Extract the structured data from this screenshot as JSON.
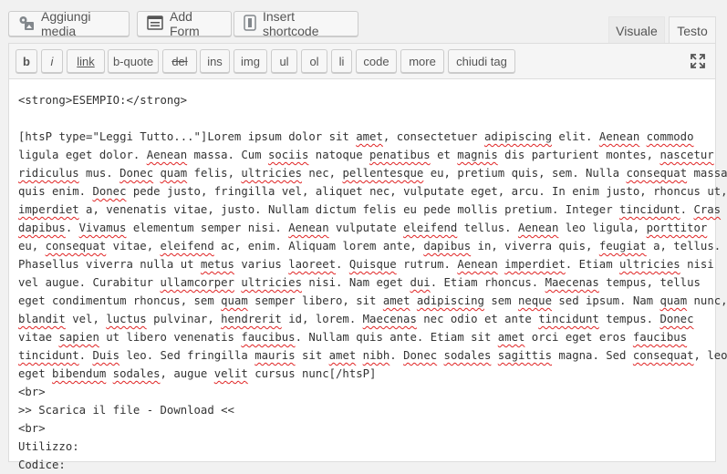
{
  "media_buttons": [
    {
      "label": "Aggiungi media",
      "icon": "media-icon"
    },
    {
      "label": "Add Form",
      "icon": "form-icon"
    },
    {
      "label": "Insert shortcode",
      "icon": "shortcode-icon"
    }
  ],
  "tabs": {
    "visual": "Visuale",
    "text": "Testo"
  },
  "quicktags": [
    "b",
    "i",
    "link",
    "b-quote",
    "del",
    "ins",
    "img",
    "ul",
    "ol",
    "li",
    "code",
    "more",
    "chiudi tag"
  ],
  "content": {
    "lines": [
      "<strong>ESEMPIO:</strong>",
      "",
      "[htsP type=\"Leggi Tutto...\"]Lorem ipsum dolor sit amet, consectetuer adipiscing elit. Aenean commodo",
      "ligula eget dolor. Aenean massa. Cum sociis natoque penatibus et magnis dis parturient montes, nascetur",
      "ridiculus mus. Donec quam felis, ultricies nec, pellentesque eu, pretium quis, sem. Nulla consequat massa",
      "quis enim. Donec pede justo, fringilla vel, aliquet nec, vulputate eget, arcu. In enim justo, rhoncus ut,",
      "imperdiet a, venenatis vitae, justo. Nullam dictum felis eu pede mollis pretium. Integer tincidunt. Cras",
      "dapibus. Vivamus elementum semper nisi. Aenean vulputate eleifend tellus. Aenean leo ligula, porttitor",
      "eu, consequat vitae, eleifend ac, enim. Aliquam lorem ante, dapibus in, viverra quis, feugiat a, tellus.",
      "Phasellus viverra nulla ut metus varius laoreet. Quisque rutrum. Aenean imperdiet. Etiam ultricies nisi",
      "vel augue. Curabitur ullamcorper ultricies nisi. Nam eget dui. Etiam rhoncus. Maecenas tempus, tellus",
      "eget condimentum rhoncus, sem quam semper libero, sit amet adipiscing sem neque sed ipsum. Nam quam nunc,",
      "blandit vel, luctus pulvinar, hendrerit id, lorem. Maecenas nec odio et ante tincidunt tempus. Donec",
      "vitae sapien ut libero venenatis faucibus. Nullam quis ante. Etiam sit amet orci eget eros faucibus",
      "tincidunt. Duis leo. Sed fringilla mauris sit amet nibh. Donec sodales sagittis magna. Sed consequat, leo",
      "eget bibendum sodales, augue velit cursus nunc[/htsP]",
      "<br>",
      ">> Scarica il file - Download <<",
      "<br>",
      "Utilizzo:",
      "Codice:"
    ],
    "misspelled": [
      "amet",
      "adipiscing",
      "Aenean",
      "commodo",
      "sociis",
      "penatibus",
      "magnis",
      "nascetur",
      "ridiculus",
      "Donec",
      "quam",
      "ultricies",
      "pellentesque",
      "consequat",
      "imperdiet",
      "tincidunt",
      "Cras",
      "dapibus",
      "Vivamus",
      "eleifend",
      "porttitor",
      "feugiat",
      "metus",
      "laoreet",
      "Quisque",
      "ullamcorper",
      "dui",
      "Maecenas",
      "neque",
      "blandit",
      "luctus",
      "hendrerit",
      "sapien",
      "faucibus",
      "Duis",
      "mauris",
      "nibh",
      "sodales",
      "sagittis",
      "bibendum",
      "velit"
    ]
  },
  "colors": {
    "spellcheck": "#e02424",
    "toolbar_bg": "#f5f5f5",
    "border": "#dddddd"
  }
}
